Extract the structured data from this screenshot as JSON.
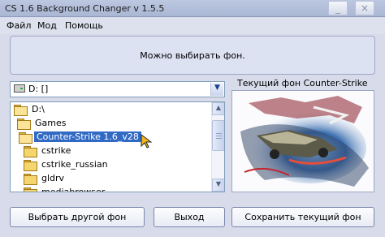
{
  "window": {
    "title": "CS 1.6 Background Changer v 1.5.5",
    "controls": {
      "minimize": "_",
      "close": "×"
    }
  },
  "menu": {
    "file": "Файл",
    "mod": "Мод",
    "help": "Помощь"
  },
  "info_panel": {
    "text": "Можно выбирать фон."
  },
  "drive_select": {
    "value": "D: []"
  },
  "folder_tree": {
    "items": [
      {
        "label": "D:\\"
      },
      {
        "label": "Games"
      },
      {
        "label": "Counter-Strike 1.6_v28",
        "selected": true
      },
      {
        "label": "cstrike"
      },
      {
        "label": "cstrike_russian"
      },
      {
        "label": "gldrv"
      },
      {
        "label": "mediabrowser"
      }
    ]
  },
  "preview": {
    "title": "Текущий фон Counter-Strike"
  },
  "buttons": {
    "choose_bg": "Выбрать другой фон",
    "exit": "Выход",
    "save_bg": "Сохранить текущий фон"
  },
  "icons": {
    "drive": "drive-icon",
    "folder": "folder-icon",
    "dropdown": "chevron-down-icon",
    "scroll_up": "arrow-up-icon",
    "scroll_down": "arrow-down-icon"
  }
}
